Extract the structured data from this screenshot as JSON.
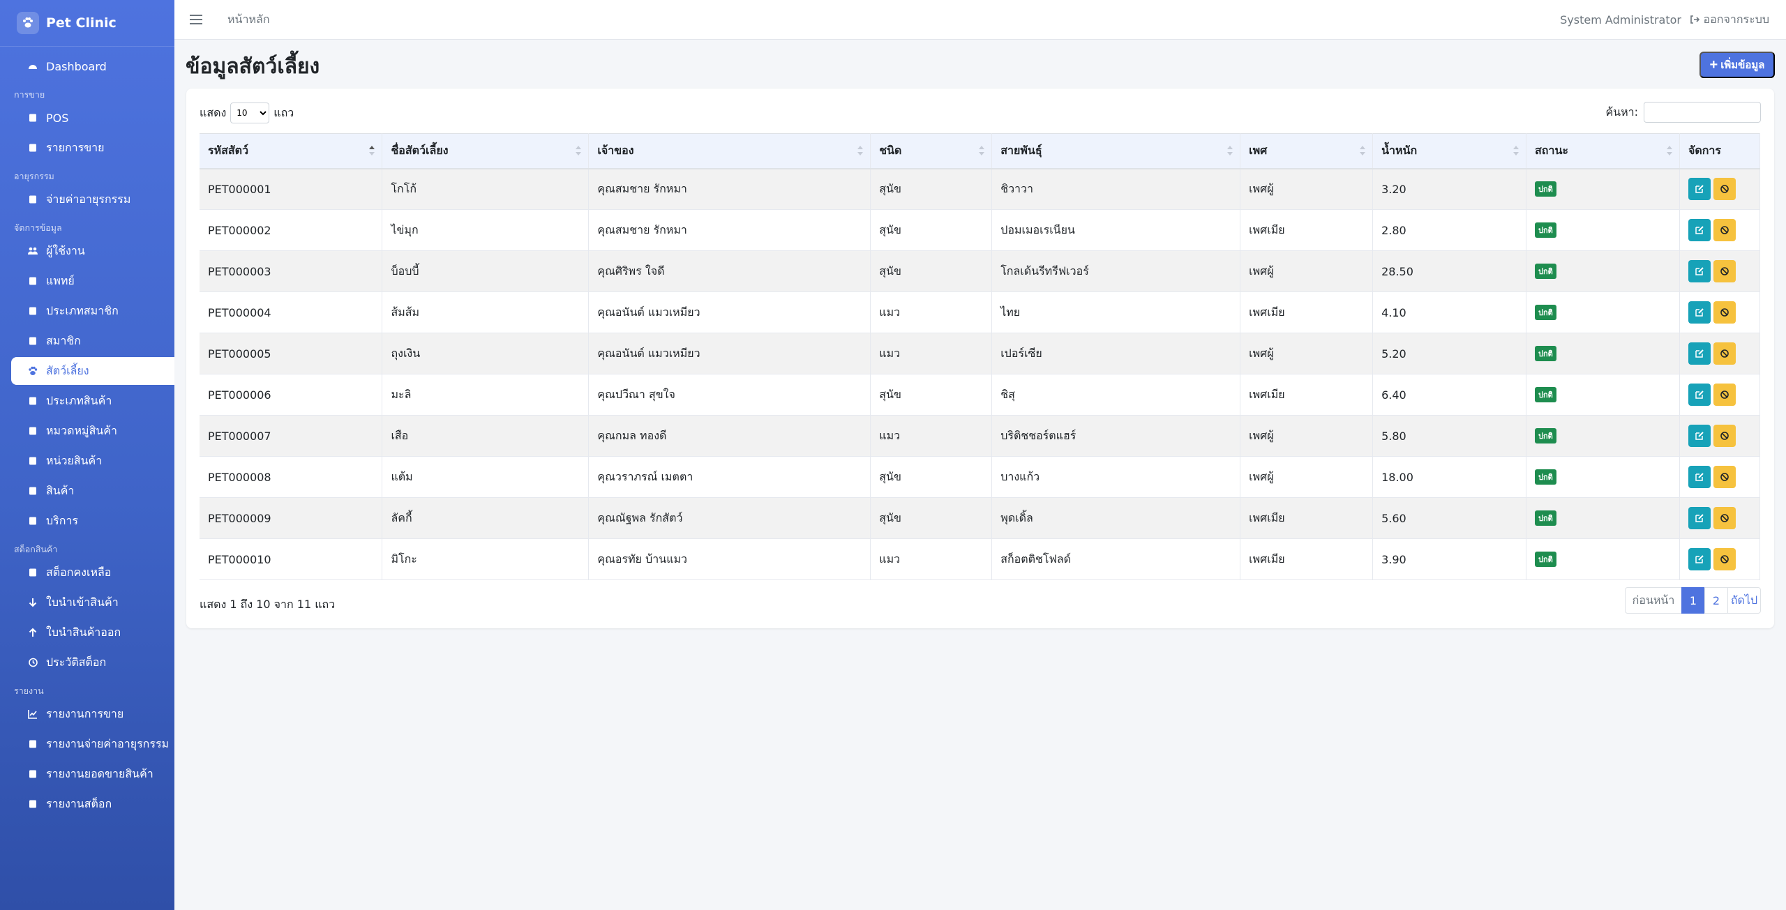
{
  "brand": {
    "name": "Pet Clinic"
  },
  "sidebar": {
    "sections": [
      {
        "header": "",
        "items": [
          {
            "label": "Dashboard",
            "icon": "gauge-icon"
          }
        ]
      },
      {
        "header": "การขาย",
        "items": [
          {
            "label": "POS",
            "icon": "cash-register-icon"
          },
          {
            "label": "รายการขาย",
            "icon": "receipt-icon"
          }
        ]
      },
      {
        "header": "อายุรกรรม",
        "items": [
          {
            "label": "จ่ายค่าอายุรกรรม",
            "icon": "file-invoice-icon"
          }
        ]
      },
      {
        "header": "จัดการข้อมูล",
        "items": [
          {
            "label": "ผู้ใช้งาน",
            "icon": "users-icon"
          },
          {
            "label": "แพทย์",
            "icon": "doctor-icon"
          },
          {
            "label": "ประเภทสมาชิก",
            "icon": "id-card-icon"
          },
          {
            "label": "สมาชิก",
            "icon": "address-book-icon"
          },
          {
            "label": "สัตว์เลี้ยง",
            "icon": "paw-icon",
            "active": true
          },
          {
            "label": "ประเภทสินค้า",
            "icon": "tags-icon"
          },
          {
            "label": "หมวดหมู่สินค้า",
            "icon": "layers-icon"
          },
          {
            "label": "หน่วยสินค้า",
            "icon": "ruler-icon"
          },
          {
            "label": "สินค้า",
            "icon": "box-icon"
          },
          {
            "label": "บริการ",
            "icon": "stethoscope-icon"
          }
        ]
      },
      {
        "header": "สต็อกสินค้า",
        "items": [
          {
            "label": "สต็อกคงเหลือ",
            "icon": "warehouse-icon"
          },
          {
            "label": "ใบนำเข้าสินค้า",
            "icon": "arrow-down-icon"
          },
          {
            "label": "ใบนำสินค้าออก",
            "icon": "arrow-up-icon"
          },
          {
            "label": "ประวัติสต็อก",
            "icon": "history-icon"
          }
        ]
      },
      {
        "header": "รายงาน",
        "items": [
          {
            "label": "รายงานการขาย",
            "icon": "chart-line-icon"
          },
          {
            "label": "รายงานจ่ายค่าอายุรกรรม",
            "icon": "hand-holding-icon"
          },
          {
            "label": "รายงานยอดขายสินค้า",
            "icon": "pills-icon"
          },
          {
            "label": "รายงานสต็อก",
            "icon": "clipboard-icon"
          }
        ]
      }
    ]
  },
  "topbar": {
    "home": "หน้าหลัก",
    "user": "System Administrator",
    "logout": "ออกจากระบบ"
  },
  "page": {
    "title": "ข้อมูลสัตว์เลี้ยง",
    "add_button": "เพิ่มข้อมูล"
  },
  "table_controls": {
    "show_prefix": "แสดง",
    "show_value": "10",
    "show_suffix": "แถว",
    "search_label": "ค้นหา:"
  },
  "table": {
    "columns": [
      "รหัสสัตว์",
      "ชื่อสัตว์เลี้ยง",
      "เจ้าของ",
      "ชนิด",
      "สายพันธุ์",
      "เพศ",
      "น้ำหนัก",
      "สถานะ",
      "จัดการ"
    ],
    "rows": [
      [
        "PET000001",
        "โกโก้",
        "คุณสมชาย รักหมา",
        "สุนัข",
        "ชิวาวา",
        "เพศผู้",
        "3.20",
        "ปกติ"
      ],
      [
        "PET000002",
        "ไข่มุก",
        "คุณสมชาย รักหมา",
        "สุนัข",
        "ปอมเมอเรเนียน",
        "เพศเมีย",
        "2.80",
        "ปกติ"
      ],
      [
        "PET000003",
        "บ็อบบี้",
        "คุณศิริพร ใจดี",
        "สุนัข",
        "โกลเด้นรีทรีฟเวอร์",
        "เพศผู้",
        "28.50",
        "ปกติ"
      ],
      [
        "PET000004",
        "ส้มส้ม",
        "คุณอนันต์ แมวเหมียว",
        "แมว",
        "ไทย",
        "เพศเมีย",
        "4.10",
        "ปกติ"
      ],
      [
        "PET000005",
        "ถุงเงิน",
        "คุณอนันต์ แมวเหมียว",
        "แมว",
        "เปอร์เซีย",
        "เพศผู้",
        "5.20",
        "ปกติ"
      ],
      [
        "PET000006",
        "มะลิ",
        "คุณปวีณา สุขใจ",
        "สุนัข",
        "ชิสุ",
        "เพศเมีย",
        "6.40",
        "ปกติ"
      ],
      [
        "PET000007",
        "เสือ",
        "คุณกมล ทองดี",
        "แมว",
        "บริติชชอร์ตแฮร์",
        "เพศผู้",
        "5.80",
        "ปกติ"
      ],
      [
        "PET000008",
        "แต้ม",
        "คุณวราภรณ์ เมตตา",
        "สุนัข",
        "บางแก้ว",
        "เพศผู้",
        "18.00",
        "ปกติ"
      ],
      [
        "PET000009",
        "ลัคกี้",
        "คุณณัฐพล รักสัตว์",
        "สุนัข",
        "พุดเดิ้ล",
        "เพศเมีย",
        "5.60",
        "ปกติ"
      ],
      [
        "PET000010",
        "มิโกะ",
        "คุณอรทัย บ้านแมว",
        "แมว",
        "สก็อตติชโฟลด์",
        "เพศเมีย",
        "3.90",
        "ปกติ"
      ]
    ]
  },
  "footer": {
    "info": "แสดง 1 ถึง 10 จาก 11 แถว",
    "prev": "ก่อนหน้า",
    "page1": "1",
    "page2": "2",
    "next": "ถัดไป"
  },
  "colors": {
    "primary": "#4e73df",
    "edit": "#17a2b8",
    "block": "#f6c23e",
    "status": "#1e8d4f"
  }
}
